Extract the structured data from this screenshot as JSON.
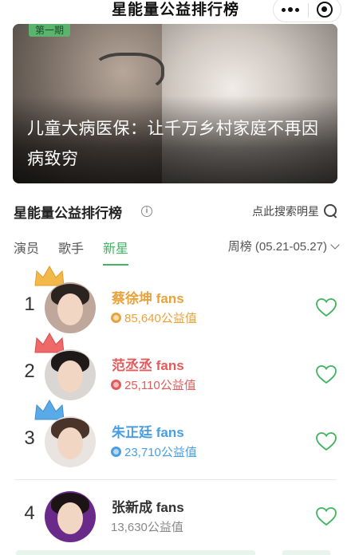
{
  "header": {
    "title": "星能量公益排行榜"
  },
  "banner": {
    "tag": "第一期",
    "headline": "儿童大病医保：让千万乡村家庭不再因病致穷"
  },
  "section": {
    "title": "星能量公益排行榜",
    "search_label": "点此搜索明星"
  },
  "tabs": [
    {
      "label": "演员",
      "active": false
    },
    {
      "label": "歌手",
      "active": false
    },
    {
      "label": "新星",
      "active": true
    }
  ],
  "week": {
    "label": "周榜 (05.21-05.27)"
  },
  "colors": {
    "accent": "#3fb560",
    "gold": "#e8a33d",
    "red": "#e35a5a",
    "blue": "#4a9ee0",
    "gray": "#333333"
  },
  "ranking": [
    {
      "rank": "1",
      "name": "蔡徐坤 fans",
      "points": "85,640公益值",
      "color": "#e8a33d"
    },
    {
      "rank": "2",
      "name": "范丞丞 fans",
      "points": "25,110公益值",
      "color": "#e35a5a"
    },
    {
      "rank": "3",
      "name": "朱正廷 fans",
      "points": "23,710公益值",
      "color": "#4a9ee0"
    },
    {
      "rank": "4",
      "name": "张新成 fans",
      "points": "13,630公益值",
      "color": "#333333"
    }
  ]
}
